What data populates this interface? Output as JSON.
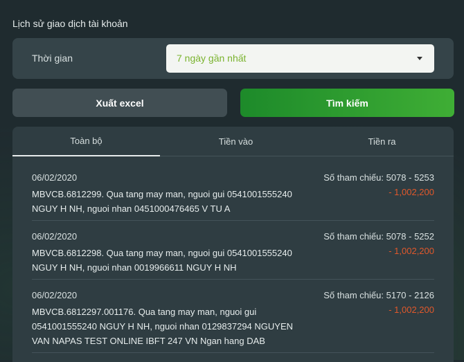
{
  "page": {
    "title": "Lịch sử giao dịch tài khoản"
  },
  "filter": {
    "label": "Thời gian",
    "selected": "7 ngày gần nhất"
  },
  "buttons": {
    "export": "Xuất excel",
    "search": "Tìm kiếm"
  },
  "tabs": [
    {
      "label": "Toàn bộ",
      "active": true
    },
    {
      "label": "Tiền vào",
      "active": false
    },
    {
      "label": "Tiền ra",
      "active": false
    }
  ],
  "transactions": [
    {
      "date": "06/02/2020",
      "ref": "Số tham chiếu: 5078 - 5253",
      "amount": "- 1,002,200",
      "desc_lines": [
        "MBVCB.6812299. Qua tang may man, nguoi gui 0541001555240",
        "NGUY H NH, nguoi nhan 0451000476465 V TU A"
      ]
    },
    {
      "date": "06/02/2020",
      "ref": "Số tham chiếu: 5078 - 5252",
      "amount": "- 1,002,200",
      "desc_lines": [
        "MBVCB.6812298. Qua tang may man, nguoi gui 0541001555240",
        "NGUY H NH, nguoi nhan 0019966611 NGUY H NH"
      ]
    },
    {
      "date": "06/02/2020",
      "ref": "Số tham chiếu: 5170 - 2126",
      "amount": "- 1,002,200",
      "desc_lines": [
        "MBVCB.6812297.001176. Qua tang may man, nguoi gui",
        "0541001555240 NGUY H NH, nguoi nhan 0129837294 NGUYEN",
        "VAN NAPAS TEST ONLINE IBFT 247 VN Ngan hang DAB"
      ]
    }
  ],
  "colors": {
    "accent_green": "#3fae35",
    "negative_amount": "#e0582b",
    "select_text": "#7ab32e"
  }
}
